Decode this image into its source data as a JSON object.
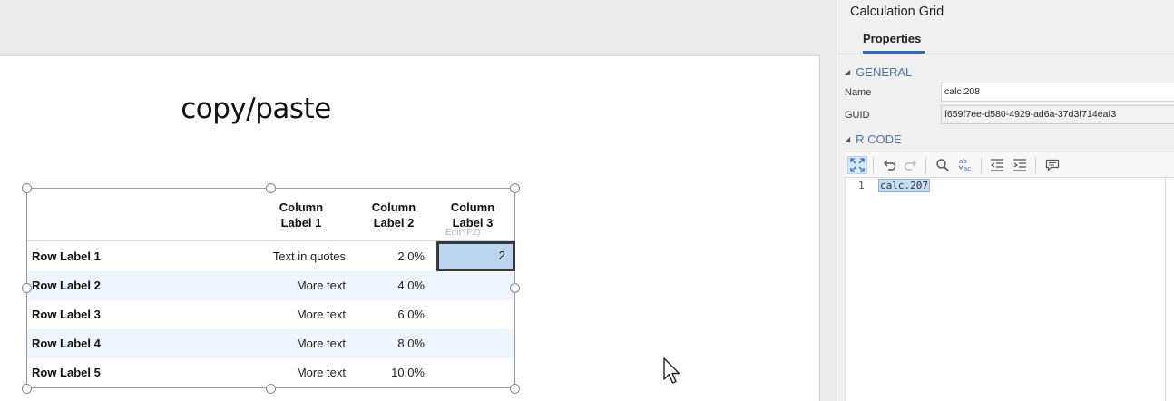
{
  "canvas": {
    "page_title": "copy/paste"
  },
  "grid": {
    "columns": [
      "Column\nLabel 1",
      "Column\nLabel 2",
      "Column\nLabel 3"
    ],
    "column_lines": [
      [
        "Column",
        "Label 1"
      ],
      [
        "Column",
        "Label 2"
      ],
      [
        "Column",
        "Label 3"
      ]
    ],
    "rows": [
      {
        "label": "Row Label 1",
        "c1": "Text in quotes",
        "c2": "2.0%",
        "c3": "2"
      },
      {
        "label": "Row Label 2",
        "c1": "More text",
        "c2": "4.0%",
        "c3": ""
      },
      {
        "label": "Row Label 3",
        "c1": "More text",
        "c2": "6.0%",
        "c3": ""
      },
      {
        "label": "Row Label 4",
        "c1": "More text",
        "c2": "8.0%",
        "c3": ""
      },
      {
        "label": "Row Label 5",
        "c1": "More text",
        "c2": "10.0%",
        "c3": ""
      }
    ],
    "edit_hint": "Edit (F2)",
    "selected_value": "2"
  },
  "panel": {
    "title": "Calculation Grid",
    "tab_properties": "Properties",
    "general_heading": "GENERAL",
    "name_label": "Name",
    "name_value": "calc.208",
    "guid_label": "GUID",
    "guid_value": "f659f7ee-d580-4929-ad6a-37d3f714eaf3",
    "rcode_heading": "R CODE",
    "code_line_number": "1",
    "code_text": "calc.207"
  },
  "colors": {
    "accent": "#2d6cc0",
    "selection": "#bcd6f2",
    "alt_row": "#eef5fd",
    "section_heading": "#4d6fa3"
  },
  "icons": [
    "expand-icon",
    "undo-icon",
    "redo-icon",
    "search-icon",
    "spellcheck-icon",
    "outdent-icon",
    "indent-icon",
    "comment-icon"
  ]
}
